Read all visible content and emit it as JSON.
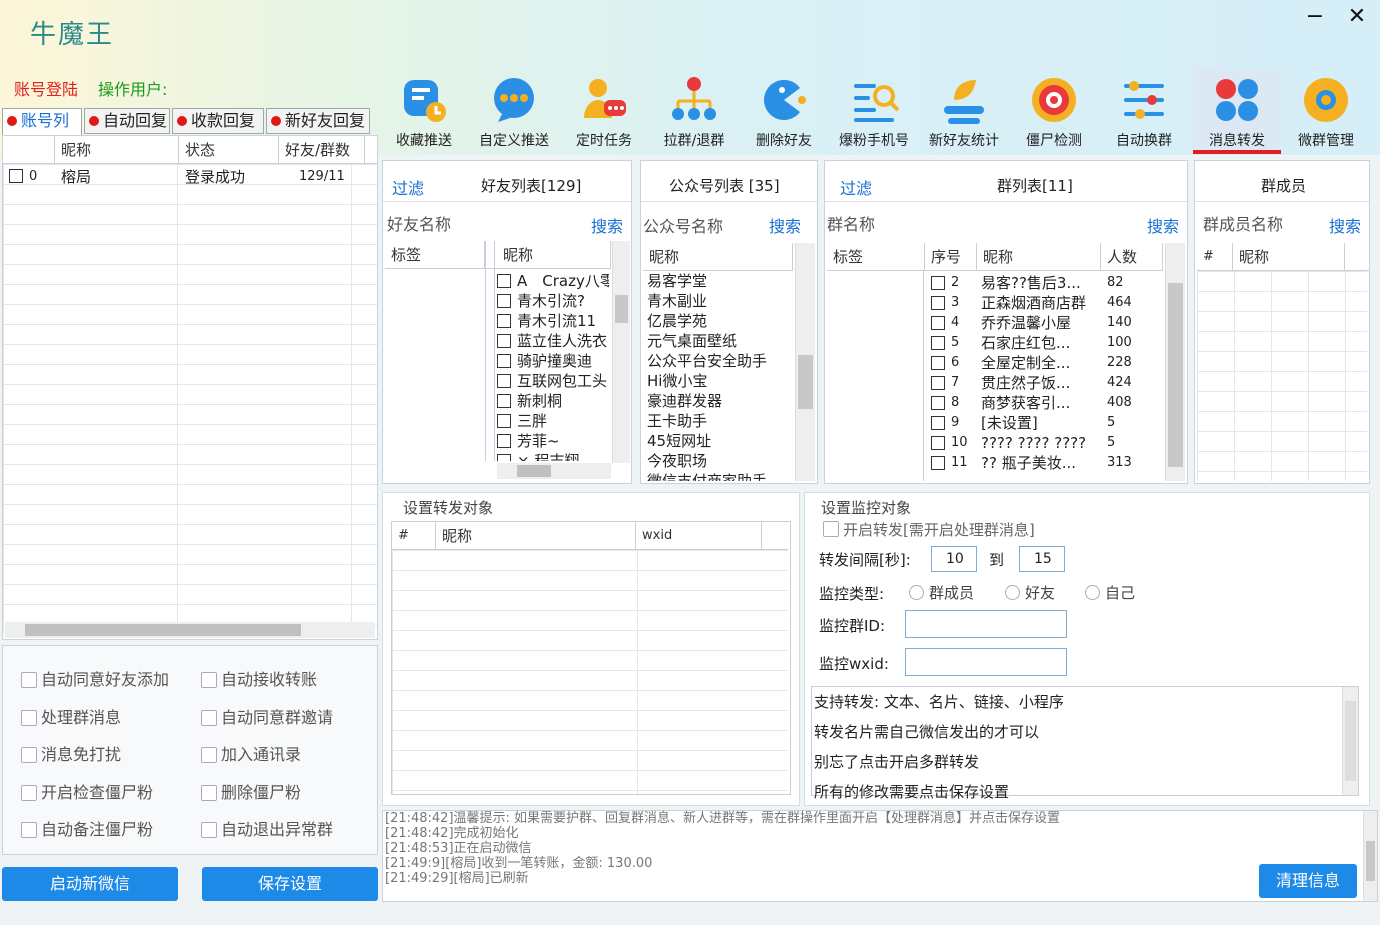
{
  "app": {
    "title": "牛魔王",
    "login": "账号登陆",
    "operator": "操作用户:",
    "min": "−",
    "close": "✕"
  },
  "tabs": [
    "账号列",
    "自动回复",
    "收款回复",
    "新好友回复"
  ],
  "toolbar": [
    {
      "label": "收藏推送",
      "icon": "favorite-push-icon"
    },
    {
      "label": "自定义推送",
      "icon": "custom-push-icon"
    },
    {
      "label": "定时任务",
      "icon": "scheduled-task-icon"
    },
    {
      "label": "拉群/退群",
      "icon": "group-join-leave-icon"
    },
    {
      "label": "删除好友",
      "icon": "delete-friend-icon"
    },
    {
      "label": "爆粉手机号",
      "icon": "phone-fans-icon"
    },
    {
      "label": "新好友统计",
      "icon": "new-friend-stats-icon"
    },
    {
      "label": "僵尸检测",
      "icon": "zombie-check-icon"
    },
    {
      "label": "自动换群",
      "icon": "auto-switch-group-icon"
    },
    {
      "label": "消息转发",
      "icon": "message-forward-icon"
    },
    {
      "label": "微群管理",
      "icon": "group-manage-icon"
    }
  ],
  "accounts": {
    "headers": [
      "昵称",
      "状态",
      "好友/群数"
    ],
    "rows": [
      {
        "idx": "0",
        "name": "榕局",
        "status": "登录成功",
        "count": "129/11"
      }
    ]
  },
  "friends": {
    "filter": "过滤",
    "title": "好友列表[129]",
    "name_label": "好友名称",
    "search": "搜索",
    "col_tag": "标签",
    "col_nick": "昵称",
    "items": [
      "A　Crazy八零",
      "青木引流?",
      "青木引流11",
      "蓝立佳人洗衣",
      "骑驴撞奥迪",
      "互联网包工头",
      "新刺桐",
      "三胖",
      "芳菲~",
      "× 程志翔"
    ]
  },
  "official": {
    "title": "公众号列表 [35]",
    "name_label": "公众号名称",
    "search": "搜索",
    "col_nick": "昵称",
    "items": [
      "易客学堂",
      "青木副业",
      "亿晨学苑",
      "元气桌面壁纸",
      "公众平台安全助手",
      "Hi微小宝",
      "豪迪群发器",
      "王卡助手",
      "45短网址",
      "今夜职场",
      "微信支付商家助手"
    ]
  },
  "groups": {
    "filter": "过滤",
    "title": "群列表[11]",
    "name_label": "群名称",
    "search": "搜索",
    "col_tag": "标签",
    "col_idx": "序号",
    "col_name": "昵称",
    "col_count": "人数",
    "rows": [
      {
        "i": "2",
        "n": "易客??售后3...",
        "c": "82"
      },
      {
        "i": "3",
        "n": "正森烟酒商店群",
        "c": "464"
      },
      {
        "i": "4",
        "n": "乔乔温馨小屋",
        "c": "140"
      },
      {
        "i": "5",
        "n": "石家庄红包...",
        "c": "100"
      },
      {
        "i": "6",
        "n": "全屋定制全...",
        "c": "228"
      },
      {
        "i": "7",
        "n": "贯庄然子饭...",
        "c": "424"
      },
      {
        "i": "8",
        "n": "商梦获客引...",
        "c": "408"
      },
      {
        "i": "9",
        "n": "[未设置]",
        "c": "5"
      },
      {
        "i": "10",
        "n": "???? ???? ????",
        "c": "5"
      },
      {
        "i": "11",
        "n": "?? 瓶子美妆...",
        "c": "313"
      }
    ]
  },
  "members": {
    "title": "群成员",
    "name_label": "群成员名称",
    "search": "搜索",
    "col_hash": "#",
    "col_nick": "昵称"
  },
  "forward_target": {
    "legend": "设置转发对象",
    "col_hash": "#",
    "col_nick": "昵称",
    "col_wxid": "wxid"
  },
  "monitor": {
    "legend": "设置监控对象",
    "enable": "开启转发[需开启处理群消息]",
    "interval_label": "转发间隔[秒]:",
    "from": "10",
    "to_label": "到",
    "to": "15",
    "type_label": "监控类型:",
    "types": [
      "群成员",
      "好友",
      "自己"
    ],
    "group_id_label": "监控群ID:",
    "wxid_label": "监控wxid:",
    "notes": [
      "支持转发: 文本、名片、链接、小程序",
      "转发名片需自己微信发出的才可以",
      "别忘了点击开启多群转发",
      "所有的修改需要点击保存设置"
    ]
  },
  "options": [
    [
      "自动同意好友添加",
      "自动接收转账"
    ],
    [
      "处理群消息",
      "自动同意群邀请"
    ],
    [
      "消息免打扰",
      "加入通讯录"
    ],
    [
      "开启检查僵尸粉",
      "删除僵尸粉"
    ],
    [
      "自动备注僵尸粉",
      "自动退出异常群"
    ]
  ],
  "buttons": {
    "start": "启动新微信",
    "save": "保存设置",
    "clear": "清理信息"
  },
  "log": [
    "[21:48:42]温馨提示: 如果需要护群、回复群消息、新人进群等，需在群操作里面开启【处理群消息】并点击保存设置",
    "[21:48:42]完成初始化",
    "[21:48:53]正在启动微信",
    "[21:49:9][榕局]收到一笔转账，金额: 130.00",
    "[21:49:29][榕局]已刷新"
  ]
}
